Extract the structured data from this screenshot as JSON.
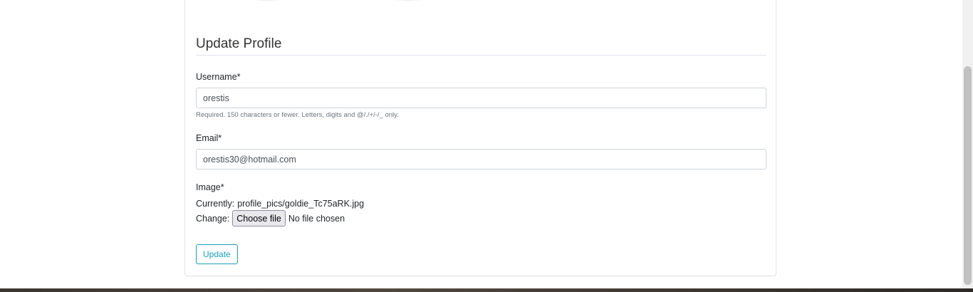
{
  "form": {
    "legend": "Update Profile",
    "username": {
      "label": "Username*",
      "value": "orestis",
      "help": "Required. 150 characters or fewer. Letters, digits and @/./+/-/_ only."
    },
    "email": {
      "label": "Email*",
      "value": "orestis30@hotmail.com"
    },
    "image": {
      "label": "Image*",
      "currently_label": "Currently:",
      "currently_value": "profile_pics/goldie_Tc75aRK.jpg",
      "change_label": "Change:",
      "choose_button": "Choose file",
      "no_file": "No file chosen"
    },
    "submit_label": "Update"
  },
  "colors": {
    "accent": "#17a2b8",
    "border": "#dee2e6"
  }
}
